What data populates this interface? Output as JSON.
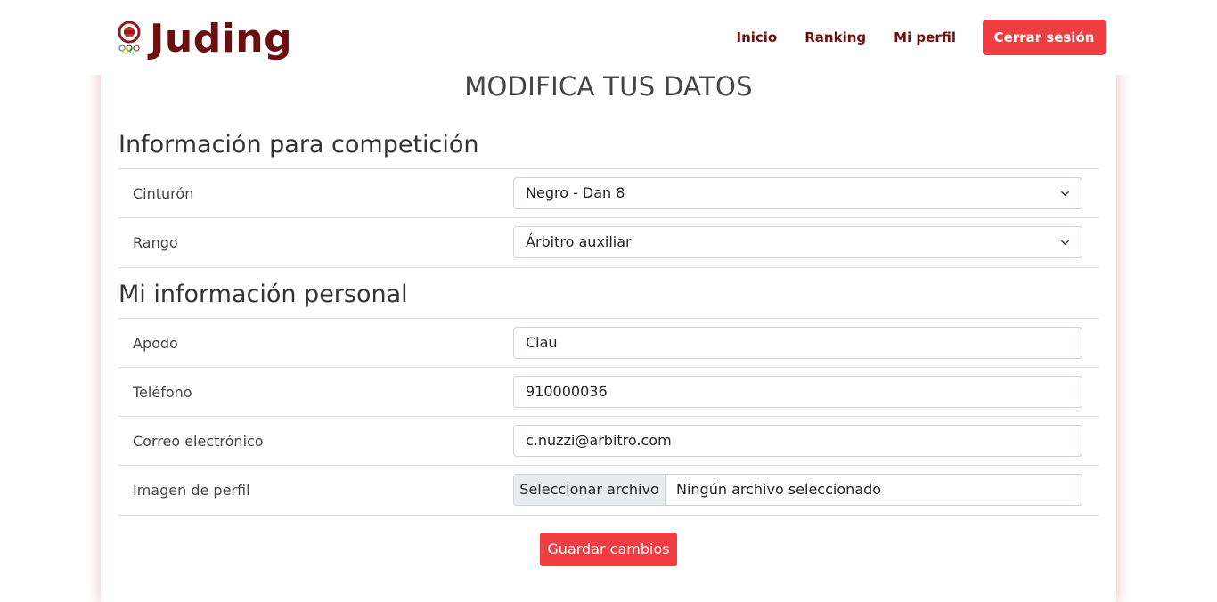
{
  "brand": {
    "name": "Juding"
  },
  "nav": {
    "links": [
      "Inicio",
      "Ranking",
      "Mi perfil"
    ],
    "logout_label": "Cerrar sesión"
  },
  "page": {
    "title": "MODIFICA TUS DATOS"
  },
  "competition": {
    "title": "Información para competición",
    "belt_label": "Cinturón",
    "belt_value": "Negro - Dan 8",
    "rank_label": "Rango",
    "rank_value": "Árbitro auxiliar"
  },
  "personal": {
    "title": "Mi información personal",
    "nickname_label": "Apodo",
    "nickname_value": "Clau",
    "phone_label": "Teléfono",
    "phone_value": "910000036",
    "email_label": "Correo electrónico",
    "email_value": "c.nuzzi@arbitro.com",
    "image_label": "Imagen de perfil",
    "file_button": "Seleccionar archivo",
    "file_status": "Ningún archivo seleccionado"
  },
  "actions": {
    "save_label": "Guardar cambios"
  },
  "colors": {
    "brand": "#6e0f0f",
    "accent": "#ef3d42"
  }
}
